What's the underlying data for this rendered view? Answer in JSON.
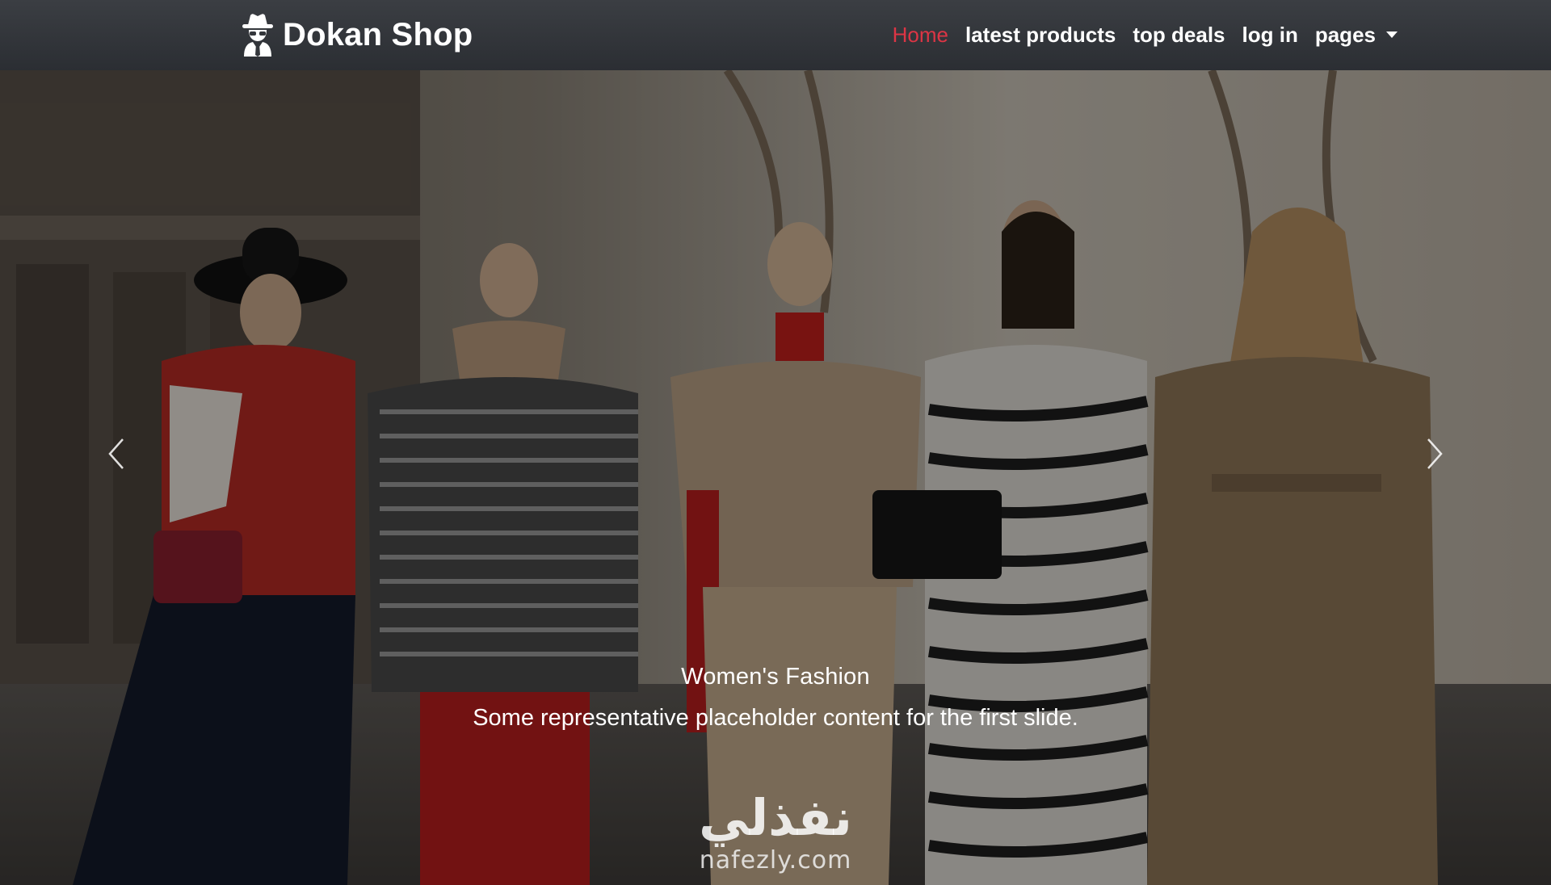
{
  "brand": {
    "name": "Dokan Shop",
    "icon": "spy-icon"
  },
  "nav": {
    "items": [
      {
        "label": "Home",
        "active": true
      },
      {
        "label": "latest products",
        "active": false
      },
      {
        "label": "top deals",
        "active": false
      },
      {
        "label": "log in",
        "active": false
      },
      {
        "label": "pages",
        "active": false,
        "dropdown": true
      }
    ]
  },
  "carousel": {
    "caption_title": "Women's Fashion",
    "caption_text": "Some representative placeholder content for the first slide.",
    "prev_icon": "chevron-left-icon",
    "next_icon": "chevron-right-icon"
  },
  "watermark": {
    "arabic": "نفذلي",
    "latin": "nafezly.com"
  },
  "colors": {
    "navbar": "#33363b",
    "active_link": "#dc3545",
    "text": "#ffffff"
  }
}
